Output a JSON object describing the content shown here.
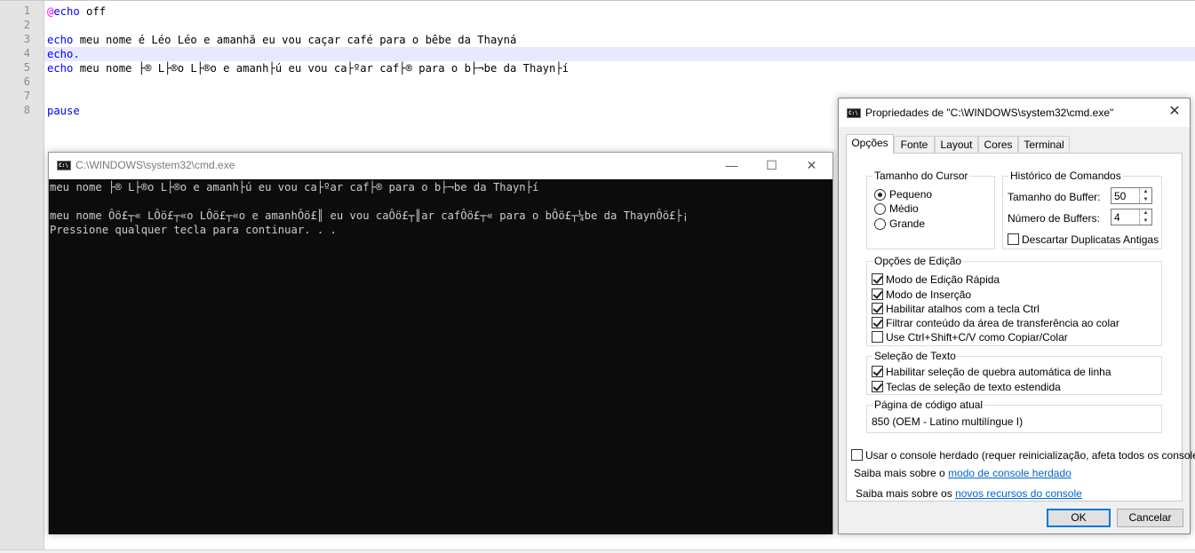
{
  "editor": {
    "line_numbers": [
      "1",
      "2",
      "3",
      "4",
      "5",
      "6",
      "7",
      "8"
    ],
    "lines": [
      {
        "prefix": "@",
        "keyword": "echo",
        "rest": " off"
      },
      {
        "prefix": "",
        "keyword": "",
        "rest": ""
      },
      {
        "prefix": "",
        "keyword": "echo",
        "rest": " meu nome é Léo Léo e amanhã eu vou caçar café para o bêbe da Thayná"
      },
      {
        "prefix": "",
        "keyword": "echo.",
        "rest": ""
      },
      {
        "prefix": "",
        "keyword": "echo",
        "rest": " meu nome ├® L├®o L├®o e amanh├ú eu vou ca├ºar caf├® para o b├¬be da Thayn├í"
      },
      {
        "prefix": "",
        "keyword": "",
        "rest": ""
      },
      {
        "prefix": "",
        "keyword": "",
        "rest": ""
      },
      {
        "prefix": "",
        "keyword": "pause",
        "rest": ""
      }
    ]
  },
  "cmd_window": {
    "title": "C:\\WINDOWS\\system32\\cmd.exe",
    "icon_text": "C:\\",
    "minimize": "—",
    "maximize": "☐",
    "close": "✕",
    "output": [
      "meu nome ├® L├®o L├®o e amanh├ú eu vou ca├ºar caf├® para o b├¬be da Thayn├í",
      "",
      "meu nome Ôö£┬« LÔö£┬«o LÔö£┬«o e amanhÔö£║ eu vou caÔö£┬║ar cafÔö£┬« para o bÔö£┬¼be da ThaynÔö£├¡",
      "Pressione qualquer tecla para continuar. . ."
    ]
  },
  "properties_dialog": {
    "title": "Propriedades de \"C:\\WINDOWS\\system32\\cmd.exe\"",
    "icon_text": "C:\\",
    "close": "✕",
    "tabs": [
      "Opções",
      "Fonte",
      "Layout",
      "Cores",
      "Terminal"
    ],
    "active_tab": "Opções",
    "cursor_size": {
      "legend": "Tamanho do Cursor",
      "options": [
        "Pequeno",
        "Médio",
        "Grande"
      ],
      "selected": "Pequeno"
    },
    "command_history": {
      "legend": "Histórico de Comandos",
      "buffer_size_label": "Tamanho do Buffer:",
      "buffer_size_value": "50",
      "num_buffers_label": "Número de Buffers:",
      "num_buffers_value": "4",
      "discard_duplicates_label": "Descartar Duplicatas Antigas",
      "discard_duplicates_checked": false
    },
    "edit_options": {
      "legend": "Opções de Edição",
      "items": [
        {
          "label": "Modo de Edição Rápida",
          "checked": true
        },
        {
          "label": "Modo de Inserção",
          "checked": true
        },
        {
          "label": "Habilitar atalhos com a tecla Ctrl",
          "checked": true
        },
        {
          "label": "Filtrar conteúdo da área de transferência ao colar",
          "checked": true
        },
        {
          "label": "Use Ctrl+Shift+C/V como Copiar/Colar",
          "checked": false
        }
      ]
    },
    "text_selection": {
      "legend": "Seleção de Texto",
      "items": [
        {
          "label": "Habilitar seleção de quebra automática de linha",
          "checked": true
        },
        {
          "label": "Teclas de seleção de texto estendida",
          "checked": true
        }
      ]
    },
    "code_page": {
      "legend": "Página de código atual",
      "value": "850   (OEM - Latino multilíngue I)"
    },
    "legacy_console_label": "Usar o console herdado (requer reinicialização, afeta todos os consoles)",
    "legacy_console_checked": false,
    "learn_more_1_prefix": "Saiba mais sobre o ",
    "learn_more_1_link": "modo de console herdado",
    "learn_more_2_prefix": "Saiba mais sobre os ",
    "learn_more_2_link": "novos recursos do console",
    "ok_label": "OK",
    "cancel_label": "Cancelar"
  },
  "colors": {
    "keyword": "#0000ff",
    "at_sign": "#ff00ff",
    "console_bg": "#0c0c0c",
    "console_fg": "#cccccc",
    "link": "#0066cc",
    "default_button_border": "#0078d7"
  }
}
